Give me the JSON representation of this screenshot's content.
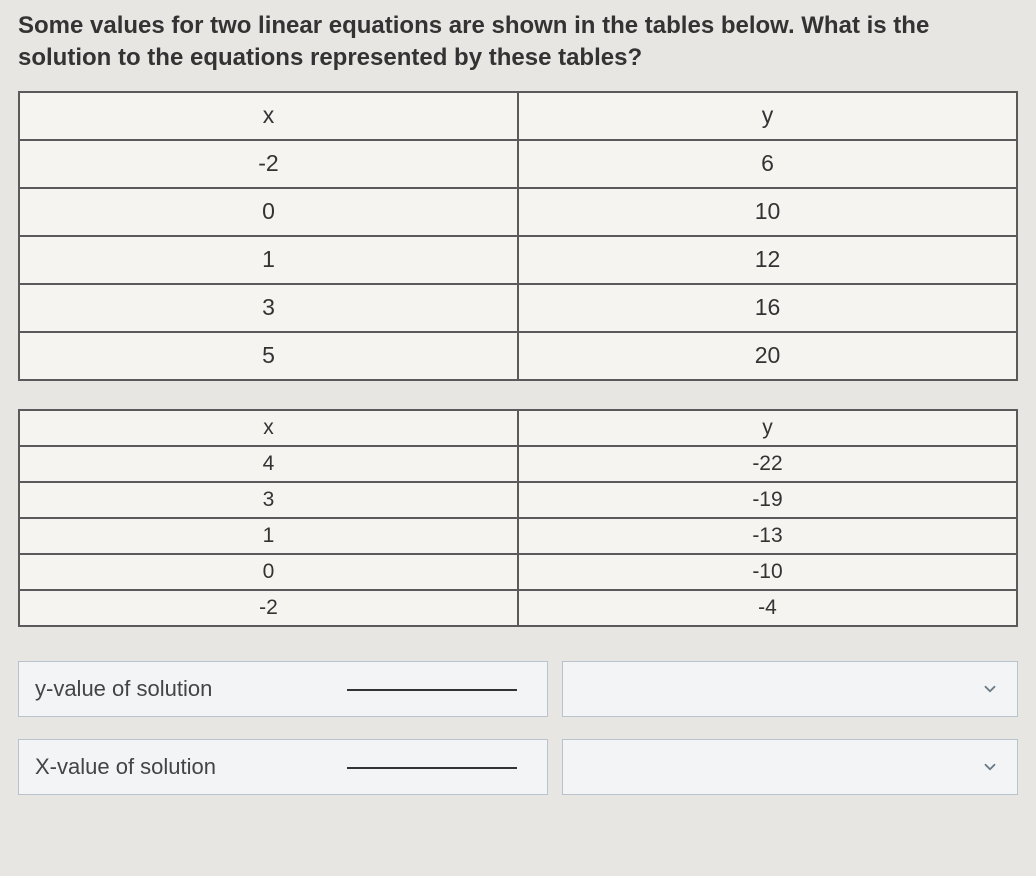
{
  "question": "Some values for two linear equations are shown in the tables below. What is the solution to the equations represented by these tables?",
  "table1": {
    "headers": {
      "c0": "x",
      "c1": "y"
    },
    "rows": [
      {
        "x": "-2",
        "y": "6"
      },
      {
        "x": "0",
        "y": "10"
      },
      {
        "x": "1",
        "y": "12"
      },
      {
        "x": "3",
        "y": "16"
      },
      {
        "x": "5",
        "y": "20"
      }
    ]
  },
  "table2": {
    "headers": {
      "c0": "x",
      "c1": "y"
    },
    "rows": [
      {
        "x": "4",
        "y": "-22"
      },
      {
        "x": "3",
        "y": "-19"
      },
      {
        "x": "1",
        "y": "-13"
      },
      {
        "x": "0",
        "y": "-10"
      },
      {
        "x": "-2",
        "y": "-4"
      }
    ]
  },
  "answers": {
    "yLabel": "y-value of solution",
    "xLabel": "X-value of solution"
  }
}
